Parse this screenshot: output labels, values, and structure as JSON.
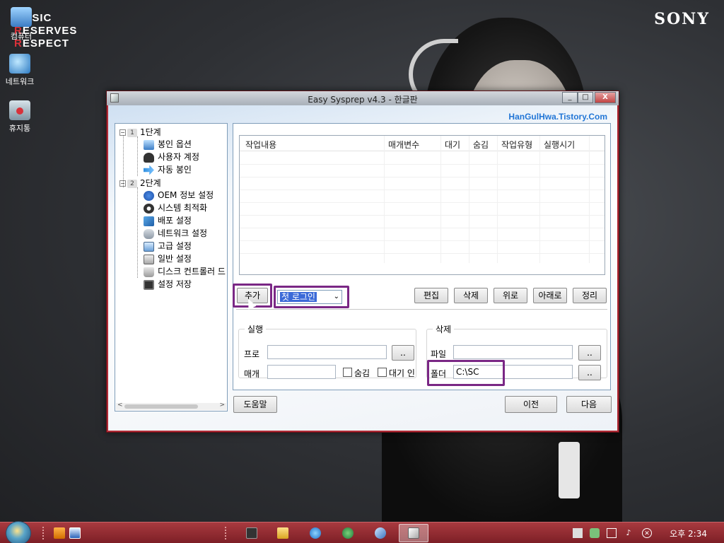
{
  "desktop": {
    "brand_logo": "SONY",
    "music_logo": {
      "line1_prefix": "M",
      "line1": "USIC",
      "line2_prefix": "R",
      "line2": "ESERVES",
      "line3_prefix": "R",
      "line3": "ESPECT"
    },
    "icons": [
      {
        "label": "컴퓨터",
        "icon": "computer-icon"
      },
      {
        "label": "네트워크",
        "icon": "network-icon"
      },
      {
        "label": "휴지통",
        "icon": "recycle-bin-icon"
      }
    ]
  },
  "window": {
    "title": "Easy Sysprep v4.3 - 한글판",
    "brand": "HanGulHwa.Tistory.Com",
    "controls": {
      "minimize": "_",
      "maximize": "□",
      "close": "X"
    }
  },
  "tree": {
    "groups": [
      {
        "expander": "−",
        "number": "1",
        "label": "1단계",
        "items": [
          "봉인 옵션",
          "사용자 계정",
          "자동 봉인"
        ]
      },
      {
        "expander": "−",
        "number": "2",
        "label": "2단계",
        "items": [
          "OEM 정보 설정",
          "시스템 최적화",
          "배포 설정",
          "네트워크 설정",
          "고급 설정",
          "일반 설정",
          "디스크 컨트롤러 드",
          "설정 저장"
        ]
      }
    ],
    "scroll_left": "<",
    "scroll_right": ">"
  },
  "table": {
    "columns": [
      "작업내용",
      "매개변수",
      "대기",
      "숨김",
      "작업유형",
      "실행시기"
    ],
    "rows": []
  },
  "toolbar": {
    "add": "추가",
    "timing_select": "첫 로그인",
    "select_arrow": "⌄",
    "edit": "편집",
    "delete": "삭제",
    "up": "위로",
    "down": "아래로",
    "sort": "정리"
  },
  "run_group": {
    "legend": "실행",
    "program_label": "프로",
    "program_value": "",
    "browse": "..",
    "param_label": "매개",
    "param_value": "",
    "hide_label": "숨김",
    "hide_checked": false,
    "wait_label": "대기 인",
    "wait_checked": false
  },
  "delete_group": {
    "legend": "삭제",
    "file_label": "파일",
    "file_value": "",
    "file_browse": "..",
    "folder_label": "폴더",
    "folder_value": "C:\\SC",
    "folder_browse": ".."
  },
  "footer": {
    "help": "도움말",
    "prev": "이전",
    "next": "다음"
  },
  "taskbar": {
    "clock": "오후 2:34",
    "tray_icons": [
      "flag-icon",
      "shield-icon",
      "network-icon",
      "volume-icon",
      "close-circle-icon"
    ]
  },
  "colors": {
    "window_frame": "#b02a35",
    "highlight_box": "#7a2785",
    "brand_text": "#2276d6",
    "taskbar": "#8e2b31"
  }
}
